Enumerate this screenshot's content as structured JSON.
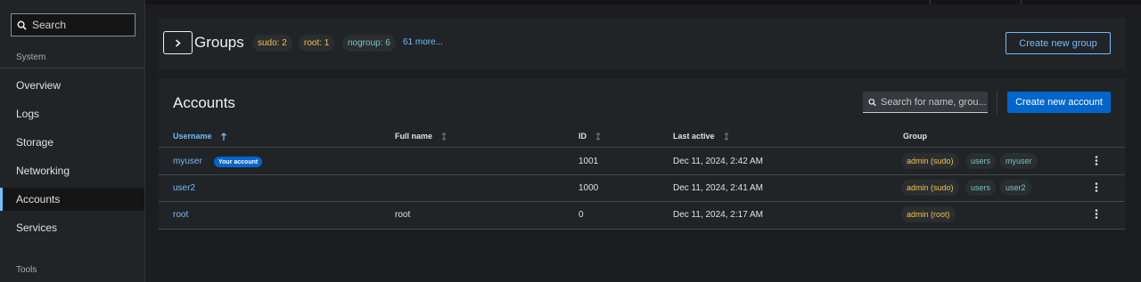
{
  "sidebar": {
    "search_placeholder": "Search",
    "system_label": "System",
    "tools_label": "Tools",
    "items": [
      {
        "label": "Overview",
        "active": false
      },
      {
        "label": "Logs",
        "active": false
      },
      {
        "label": "Storage",
        "active": false
      },
      {
        "label": "Networking",
        "active": false
      },
      {
        "label": "Accounts",
        "active": true
      },
      {
        "label": "Services",
        "active": false
      }
    ]
  },
  "groups": {
    "title": "Groups",
    "chips": [
      {
        "label": "sudo: 2",
        "color": "amber"
      },
      {
        "label": "root: 1",
        "color": "amber"
      },
      {
        "label": "nogroup: 6",
        "color": "teal"
      }
    ],
    "more_link": "61 more...",
    "create_button": "Create new group",
    "expand_icon": "chevron-right-icon"
  },
  "accounts": {
    "title": "Accounts",
    "search_placeholder": "Search for name, grou...",
    "create_button": "Create new account",
    "columns": [
      {
        "label": "Username",
        "sorted": "asc"
      },
      {
        "label": "Full name",
        "sorted": "none"
      },
      {
        "label": "ID",
        "sorted": "none"
      },
      {
        "label": "Last active",
        "sorted": "none"
      },
      {
        "label": "Group",
        "sorted": null
      }
    ],
    "rows": [
      {
        "username": "myuser",
        "badge": "Your account",
        "full_name": "",
        "id": "1001",
        "last_active": "Dec 11, 2024, 2:42 AM",
        "groups": [
          {
            "label": "admin (sudo)",
            "color": "amber"
          },
          {
            "label": "users",
            "color": "teal"
          },
          {
            "label": "myuser",
            "color": "teal"
          }
        ]
      },
      {
        "username": "user2",
        "badge": "",
        "full_name": "",
        "id": "1000",
        "last_active": "Dec 11, 2024, 2:41 AM",
        "groups": [
          {
            "label": "admin (sudo)",
            "color": "amber"
          },
          {
            "label": "users",
            "color": "teal"
          },
          {
            "label": "user2",
            "color": "teal"
          }
        ]
      },
      {
        "username": "root",
        "badge": "",
        "full_name": "root",
        "id": "0",
        "last_active": "Dec 11, 2024, 2:17 AM",
        "groups": [
          {
            "label": "admin (root)",
            "color": "amber"
          }
        ]
      }
    ]
  },
  "colors": {
    "accent_blue": "#73bcf7",
    "primary_button": "#0066cc",
    "amber_text": "#f4c145",
    "teal_text": "#73c5c5",
    "card_bg": "#212427",
    "page_bg": "#1b1d21"
  }
}
